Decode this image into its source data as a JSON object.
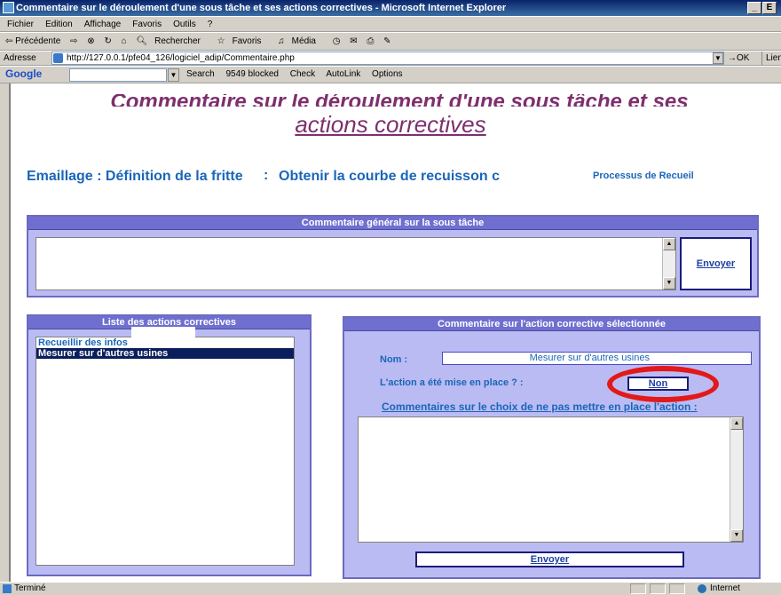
{
  "window": {
    "title": "Commentaire sur le déroulement d'une sous tâche et ses actions correctives - Microsoft Internet Explorer",
    "min": "_",
    "max": "Е"
  },
  "menu": [
    "Fichier",
    "Edition",
    "Affichage",
    "Favoris",
    "Outils",
    "?"
  ],
  "toolbar": {
    "back": "⇦ Précédente",
    "forward": "⇨",
    "search": "Rechercher",
    "favorites": "Favoris",
    "media": "Média"
  },
  "address": {
    "label": "Adresse",
    "url": "http://127.0.0.1/pfe04_126/logiciel_adip/Commentaire.php",
    "go": "OK",
    "links": "Liens"
  },
  "googlebar": {
    "logo": "Google",
    "search": "Search",
    "blocked": "9549 blocked",
    "check": "Check",
    "autolink": "AutoLink",
    "options": "Options"
  },
  "page": {
    "title_cut": "Commentaire sur le déroulement d'une sous tâche et ses",
    "title": "actions correctives",
    "task": "Emaillage : Définition de la fritte",
    "separator": ":",
    "subtask": "Obtenir la courbe de recuisson c",
    "process_link": "Processus de Recueil"
  },
  "general": {
    "header": "Commentaire général sur la sous tâche",
    "send": "Envoyer"
  },
  "actions_list": {
    "header": "Liste des actions correctives",
    "items": [
      "Recueillir des infos",
      "Mesurer sur d'autres usines"
    ]
  },
  "action_detail": {
    "header": "Commentaire sur l'action corrective sélectionnée",
    "nom_label": "Nom :",
    "nom_value": "Mesurer sur d'autres usines",
    "mise_label": "L'action a été mise en place ? :",
    "mise_value": "Non",
    "comments_heading": "Commentaires sur le choix de ne pas mettre en place l'action :",
    "send": "Envoyer"
  },
  "status": {
    "text": "Terminé",
    "zone": "Internet"
  },
  "colors": {
    "accent_blue": "#1a66b8",
    "title_purple": "#7e2f6d",
    "panel_bg": "#bbbbf3",
    "panel_head": "#6f6fd0",
    "highlight_red": "#e31818"
  }
}
